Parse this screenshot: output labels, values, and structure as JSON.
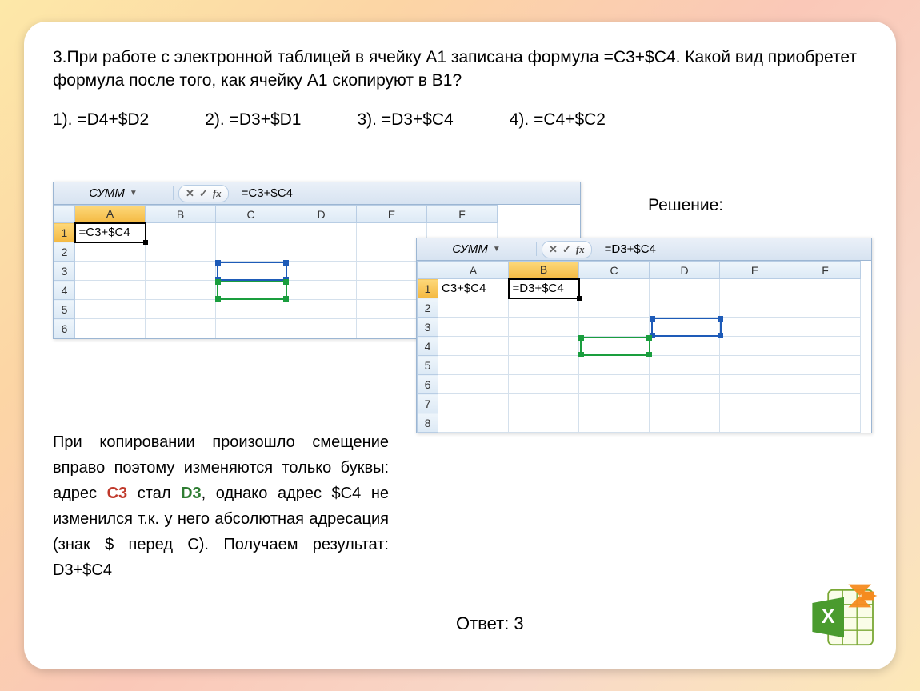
{
  "question": "3.При работе с электронной таблицей в ячейку А1 записана формула =С3+$C4. Какой вид приобретет формула после того, как  ячейку A1 скопируют в B1?",
  "options": {
    "o1": "1). =D4+$D2",
    "o2": "2). =D3+$D1",
    "o3": "3). =D3+$C4",
    "o4": "4). =C4+$C2"
  },
  "solution_label": "Решение:",
  "excel1": {
    "namebox": "СУММ",
    "formula": "=C3+$C4",
    "cols": [
      "A",
      "B",
      "C",
      "D",
      "E",
      "F"
    ],
    "rows": [
      "1",
      "2",
      "3",
      "4",
      "5",
      "6"
    ],
    "A1": "=C3+$C4"
  },
  "excel2": {
    "namebox": "СУММ",
    "formula": "=D3+$C4",
    "cols": [
      "A",
      "B",
      "C",
      "D",
      "E",
      "F"
    ],
    "rows": [
      "1",
      "2",
      "3",
      "4",
      "5",
      "6",
      "7",
      "8"
    ],
    "A1": "C3+$C4",
    "B1": "=D3+$C4"
  },
  "explanation": {
    "p1a": "При копировании произошло смещение вправо поэтому изменяются только буквы: адрес ",
    "c3": "C3",
    "p1b": " стал ",
    "d3": "D3",
    "p1c": ", однако адрес $C4 не изменился т.к. у него абсолютная адресация (знак $ перед С). Получаем результат: D3+$C4"
  },
  "answer": "Ответ: 3"
}
